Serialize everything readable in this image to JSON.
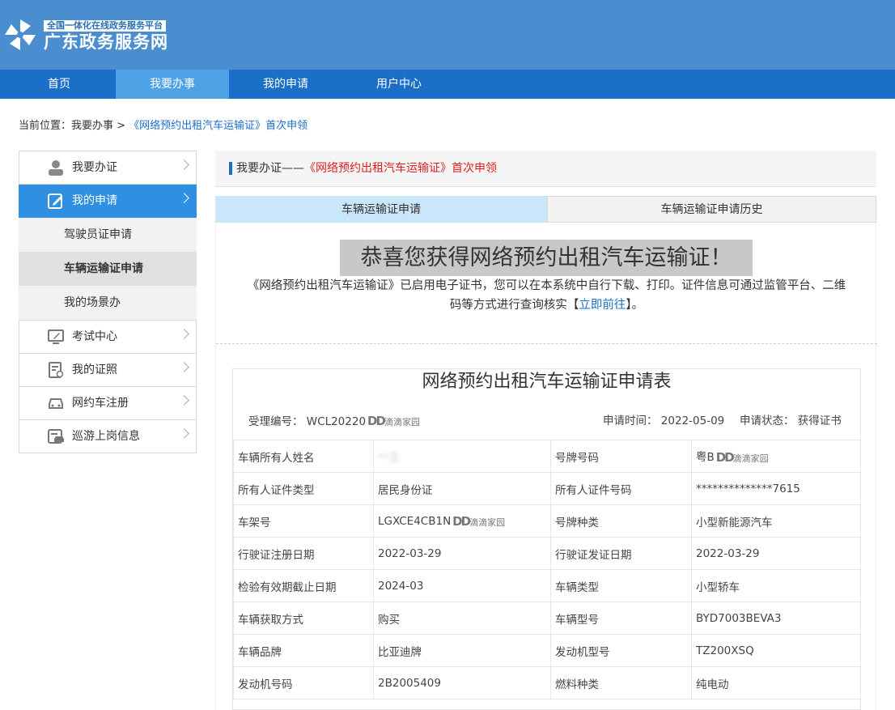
{
  "header": {
    "subtitle": "全国一体化在线政务服务平台",
    "title": "广东政务服务网",
    "brand_color": "#4a8ecf"
  },
  "nav": {
    "items": [
      "首页",
      "我要办事",
      "我的申请",
      "用户中心"
    ],
    "active": "我要办事",
    "color": "#1b6fc9"
  },
  "breadcrumb": {
    "prefix": "当前位置：我要办事 > ",
    "current": "《网络预约出租汽车运输证》首次申领"
  },
  "sidebar": {
    "items": [
      {
        "label": "我要办证",
        "icon": "user-icon"
      },
      {
        "label": "我的申请",
        "icon": "edit-form-icon"
      },
      {
        "label": "考试中心",
        "icon": "monitor-edit-icon"
      },
      {
        "label": "我的证照",
        "icon": "certificate-icon"
      },
      {
        "label": "网约车注册",
        "icon": "car-icon"
      },
      {
        "label": "巡游上岗信息",
        "icon": "taxi-id-icon"
      }
    ],
    "subitems": [
      "驾驶员证申请",
      "车辆运输证申请",
      "我的场景办"
    ],
    "active_color": "#2e8fe3"
  },
  "main": {
    "heading_prefix": "我要办证——",
    "heading_red": "《网络预约出租汽车运输证》首次申领",
    "tabs": [
      "车辆运输证申请",
      "车辆运输证申请历史"
    ],
    "congrats": "恭喜您获得网络预约出租汽车运输证！",
    "notice_line1": "《网络预约出租汽车运输证》已启用电子证书，您可以在本系统中自行下载、打印。证件信息可通过监管平台、二维",
    "notice_line2_prefix": "码等方式进行查询核实【",
    "notice_link": "立即前往",
    "notice_line2_suffix": "】。"
  },
  "form": {
    "title": "网络预约出租汽车运输证申请表",
    "accept_no_label": "受理编号：",
    "accept_no_value": "WCL20220",
    "apply_time_label": "申请时间：",
    "apply_time_value": "2022-05-09",
    "status_label": "申请状态：",
    "status_value": "获得证书",
    "watermark_dd": "DD",
    "watermark_cn": "滴滴家园",
    "rows": [
      {
        "l1": "车辆所有人姓名",
        "v1": "**王",
        "l2": "号牌号码",
        "v2": "粤B"
      },
      {
        "l1": "所有人证件类型",
        "v1": "居民身份证",
        "l2": "所有人证件号码",
        "v2": "**************7615"
      },
      {
        "l1": "车架号",
        "v1": "LGXCE4CB1N",
        "l2": "号牌种类",
        "v2": "小型新能源汽车"
      },
      {
        "l1": "行驶证注册日期",
        "v1": "2022-03-29",
        "l2": "行驶证发证日期",
        "v2": "2022-03-29"
      },
      {
        "l1": "检验有效期截止日期",
        "v1": "2024-03",
        "l2": "车辆类型",
        "v2": "小型轿车"
      },
      {
        "l1": "车辆获取方式",
        "v1": "购买",
        "l2": "车辆型号",
        "v2": "BYD7003BEVA3"
      },
      {
        "l1": "车辆品牌",
        "v1": "比亚迪牌",
        "l2": "发动机型号",
        "v2": "TZ200XSQ"
      },
      {
        "l1": "发动机号码",
        "v1": "2B2005409",
        "l2": "燃料种类",
        "v2": "纯电动"
      }
    ]
  }
}
